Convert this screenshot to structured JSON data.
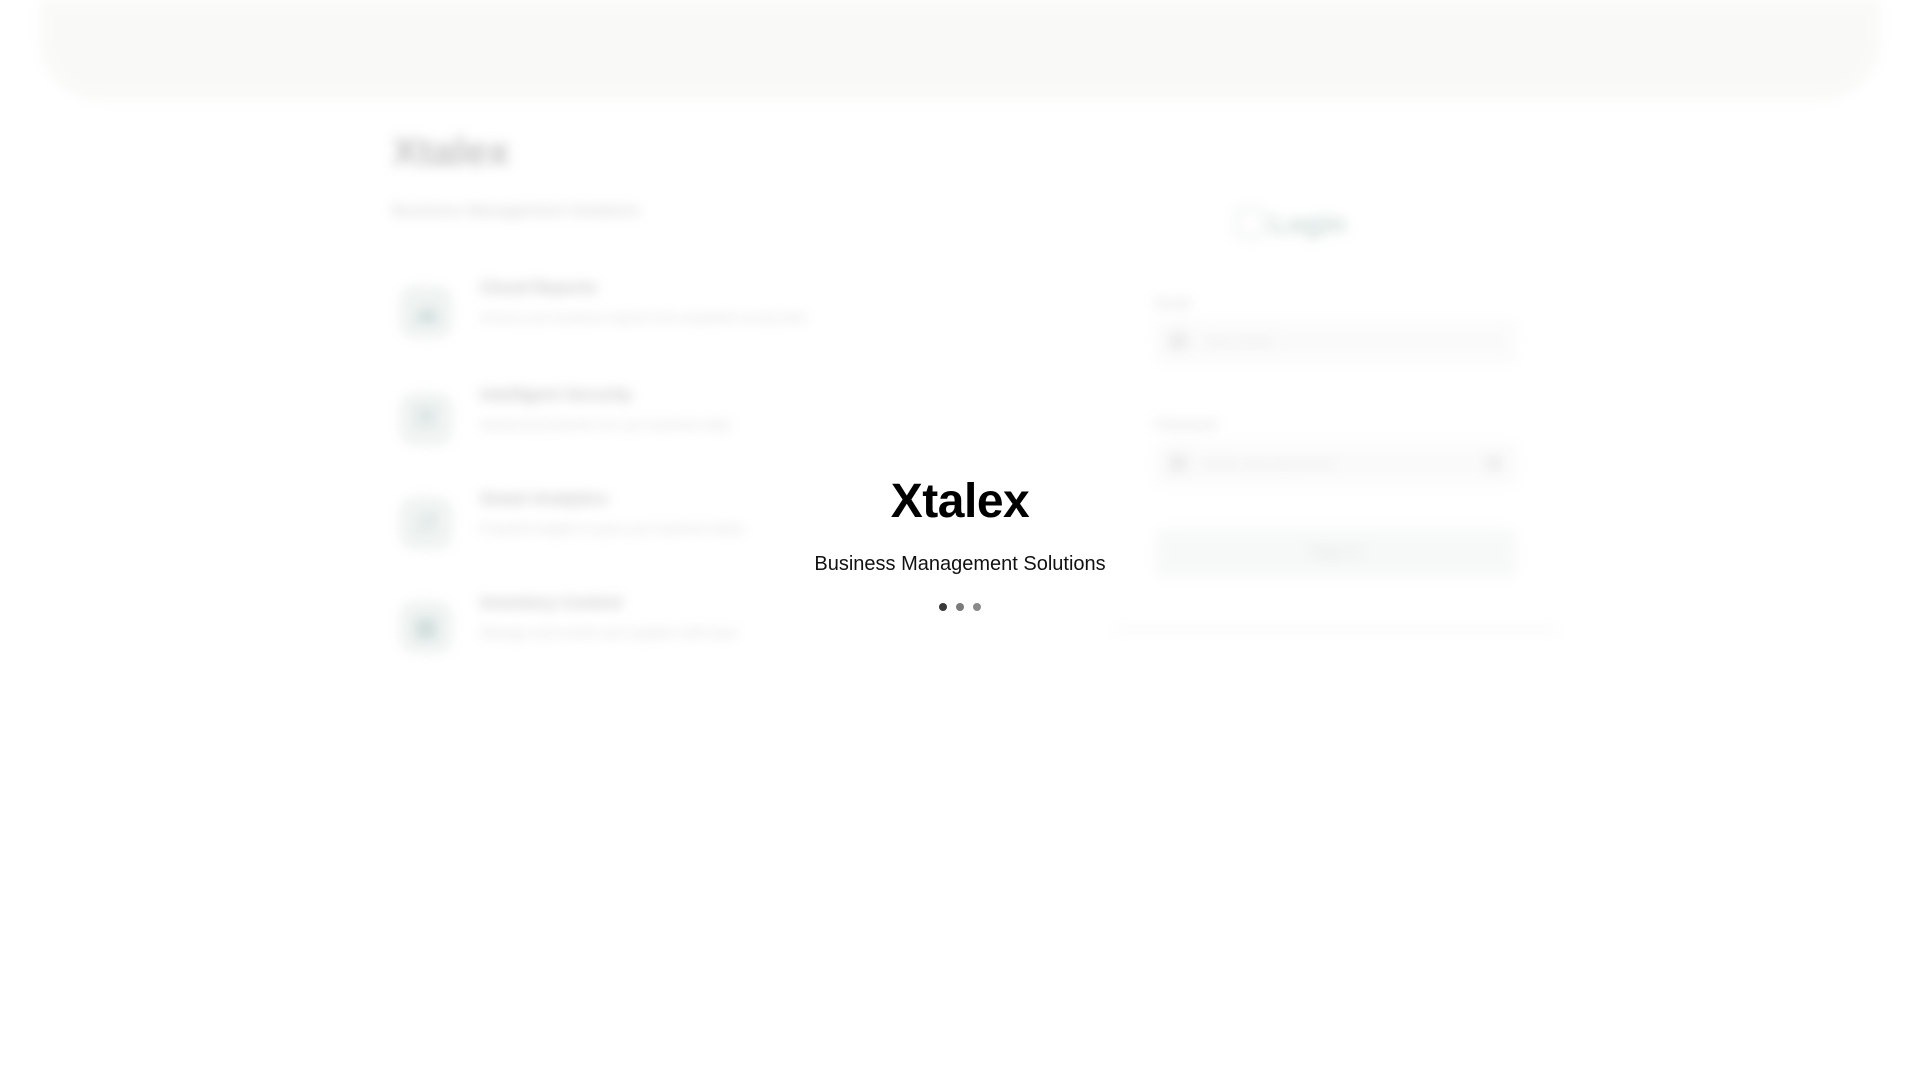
{
  "background_app": {
    "brand": "Xtalex",
    "tagline": "Business Management Solutions",
    "features": [
      {
        "icon": "cloud-icon",
        "glyph": "☁",
        "title": "Cloud Reports",
        "desc": "Access your business reports from anywhere at any time"
      },
      {
        "icon": "shield-icon",
        "glyph": "⛨",
        "title": "Intelligent Security",
        "desc": "Advanced protection for your business data"
      },
      {
        "icon": "chart-icon",
        "glyph": "↗",
        "title": "Smart Analytics",
        "desc": "Powerful insights to grow your business faster"
      },
      {
        "icon": "grid-icon",
        "glyph": "▦",
        "title": "Inventory Control",
        "desc": "Manage stock levels and suppliers with ease"
      }
    ],
    "login": {
      "title": "Login",
      "username_label": "Email",
      "username_placeholder": "Your email",
      "password_label": "Password",
      "password_placeholder": "Enter your password",
      "submit_label": "Sign In"
    }
  },
  "splash": {
    "title": "Xtalex",
    "subtitle": "Business Management Solutions",
    "loader": {
      "dot_count": 3,
      "colors": [
        "#3a3a3a",
        "#7a7a7a",
        "#8a8a8a"
      ]
    }
  }
}
